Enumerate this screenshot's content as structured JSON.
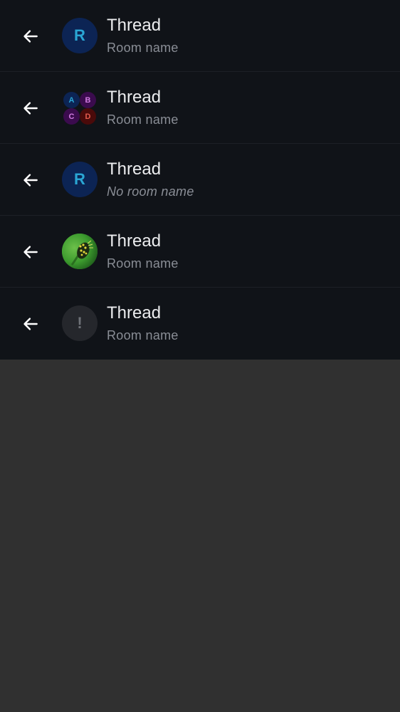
{
  "rows": [
    {
      "back_icon": "arrow-left-icon",
      "avatar_type": "letter",
      "avatar_letter": "R",
      "title": "Thread",
      "subtitle": "Room name",
      "subtitle_italic": false
    },
    {
      "back_icon": "arrow-left-icon",
      "avatar_type": "cluster",
      "cluster_letters": [
        "A",
        "B",
        "C",
        "D"
      ],
      "title": "Thread",
      "subtitle": "Room name",
      "subtitle_italic": false
    },
    {
      "back_icon": "arrow-left-icon",
      "avatar_type": "letter",
      "avatar_letter": "R",
      "title": "Thread",
      "subtitle": "No room name",
      "subtitle_italic": true
    },
    {
      "back_icon": "arrow-left-icon",
      "avatar_type": "image",
      "avatar_image": "caterpillar-photo",
      "title": "Thread",
      "subtitle": "Room name",
      "subtitle_italic": false
    },
    {
      "back_icon": "arrow-left-icon",
      "avatar_type": "error",
      "avatar_letter": "!",
      "title": "Thread",
      "subtitle": "Room name",
      "subtitle_italic": false
    }
  ],
  "colors": {
    "list_background": "#101318",
    "page_background": "#303030",
    "title": "#ecedef",
    "subtitle": "#8a8e96",
    "divider": "#1d2026"
  }
}
